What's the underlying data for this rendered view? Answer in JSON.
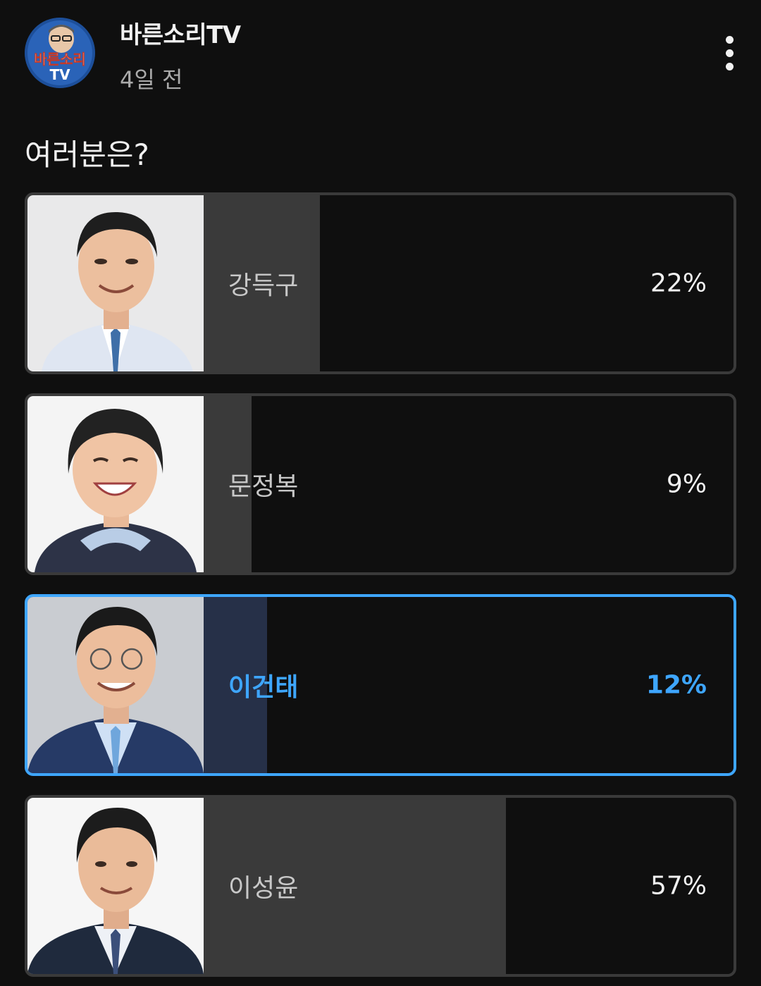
{
  "post": {
    "channel_name": "바른소리TV",
    "avatar_text_top": "바른소리",
    "avatar_text_bottom": "TV",
    "time_ago": "4일 전",
    "question": "여러분은?"
  },
  "poll": {
    "options": [
      {
        "label": "강득구",
        "percent_text": "22%",
        "percent": 22,
        "selected": false
      },
      {
        "label": "문정복",
        "percent_text": "9%",
        "percent": 9,
        "selected": false
      },
      {
        "label": "이건태",
        "percent_text": "12%",
        "percent": 12,
        "selected": true
      },
      {
        "label": "이성윤",
        "percent_text": "57%",
        "percent": 57,
        "selected": false
      }
    ]
  },
  "colors": {
    "background": "#0f0f0f",
    "accent": "#3ea6ff",
    "bar": "#3a3a3a",
    "border": "#3a3a3a"
  },
  "icons": {
    "more": "more-vertical-icon"
  }
}
